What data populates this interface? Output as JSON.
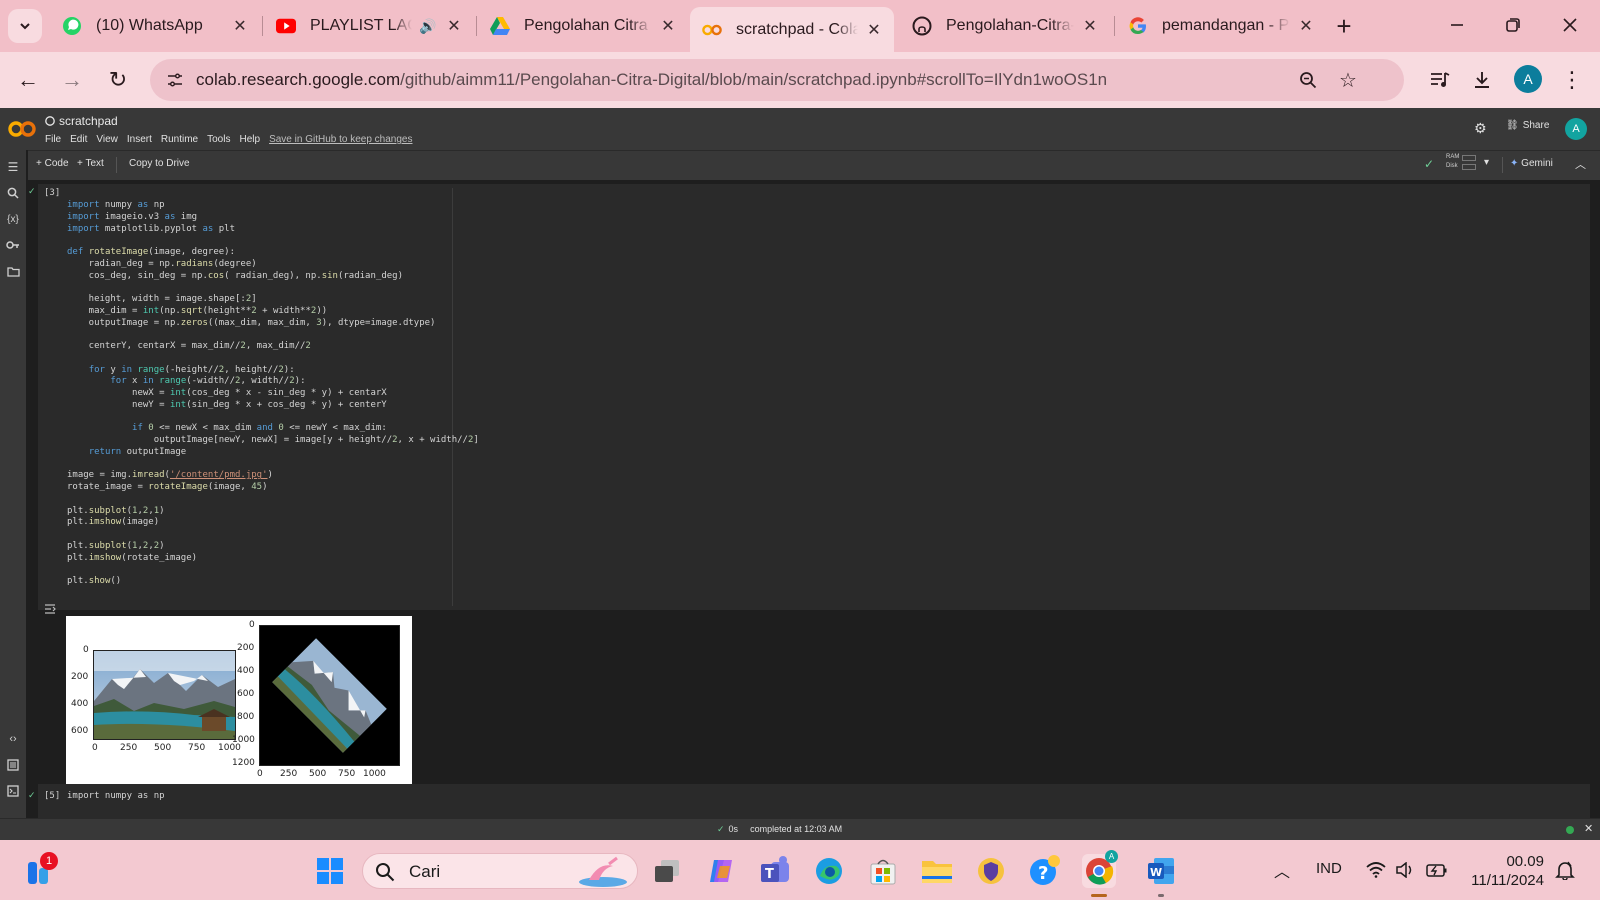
{
  "browser": {
    "tabs": [
      {
        "title": "(10) WhatsApp",
        "icon": "whatsapp-icon"
      },
      {
        "title": "PLAYLIST LAGU",
        "icon": "youtube-icon",
        "audio": true
      },
      {
        "title": "Pengolahan Citra D",
        "icon": "google-drive-icon"
      },
      {
        "title": "scratchpad - Colab",
        "icon": "colab-icon",
        "active": true
      },
      {
        "title": "Pengolahan-Citra-I",
        "icon": "github-icon"
      },
      {
        "title": "pemandangan - Pe",
        "icon": "google-icon"
      }
    ],
    "url_host": "colab.research.google.com",
    "url_path": "/github/aimm11/Pengolahan-Citra-Digital/blob/main/scratchpad.ipynb#scrollTo=IlYdn1woOS1n",
    "profile_initial": "A"
  },
  "colab": {
    "notebook_title": "scratchpad",
    "menu": [
      "File",
      "Edit",
      "View",
      "Insert",
      "Runtime",
      "Tools",
      "Help"
    ],
    "save_link": "Save in GitHub to keep changes",
    "share_label": "Share",
    "avatar_initial": "A",
    "toolbar": {
      "code_label": "+ Code",
      "text_label": "+ Text",
      "copy_label": "Copy to Drive",
      "ram_label": "RAM",
      "disk_label": "Disk",
      "gemini_label": "Gemini"
    },
    "cell1": {
      "exec_count": "[3]",
      "run_time": "0s"
    },
    "cell2": {
      "exec_count": "[5]",
      "code": "import numpy as np"
    },
    "output_figure": {
      "left_yticks": [
        "0",
        "200",
        "400",
        "600"
      ],
      "left_xticks": [
        "0",
        "250",
        "500",
        "750",
        "1000"
      ],
      "right_yticks": [
        "0",
        "200",
        "400",
        "600",
        "800",
        "1000",
        "1200"
      ],
      "right_xticks": [
        "0",
        "250",
        "500",
        "750",
        "1000"
      ]
    },
    "status": {
      "time": "0s",
      "message": "completed at 12:03 AM"
    }
  },
  "taskbar": {
    "search_placeholder": "Cari",
    "notification_badge": "1",
    "language": "IND",
    "time": "00.09",
    "date": "11/11/2024"
  }
}
